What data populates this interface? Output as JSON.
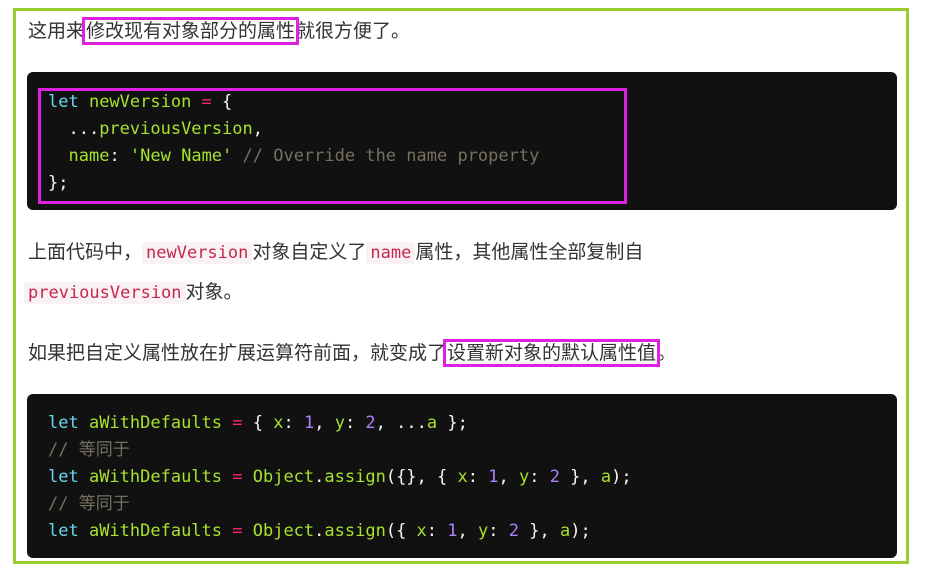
{
  "para1": {
    "before": "这用来",
    "highlight": "修改现有对象部分的属性",
    "after": "就很方便了。"
  },
  "code1": [
    [
      [
        "let ",
        "kw"
      ],
      [
        "newVersion ",
        "fn"
      ],
      [
        "= ",
        "op"
      ],
      [
        "{",
        "pl"
      ]
    ],
    [
      [
        "  ...",
        "pl"
      ],
      [
        "previousVersion",
        "fn"
      ],
      [
        ",",
        "pl"
      ]
    ],
    [
      [
        "  ",
        "pl"
      ],
      [
        "name",
        "fn"
      ],
      [
        ": ",
        "pl"
      ],
      [
        "'New Name'",
        "str"
      ],
      [
        " // Override the name property",
        "cm"
      ]
    ],
    [
      [
        "};",
        "pl"
      ]
    ]
  ],
  "para2": {
    "t1": "上面代码中，",
    "c1": "newVersion",
    "t2": "对象自定义了",
    "c2": "name",
    "t3": "属性，其他属性全部复制自",
    "c3": "previousVersion",
    "t4": "对象。"
  },
  "para3": {
    "before": "如果把自定义属性放在扩展运算符前面，就变成了",
    "highlight": "设置新对象的默认属性值",
    "after": "。"
  },
  "code2": [
    [
      [
        "let ",
        "kw"
      ],
      [
        "aWithDefaults ",
        "fn"
      ],
      [
        "= ",
        "op"
      ],
      [
        "{ ",
        "pl"
      ],
      [
        "x",
        "fn"
      ],
      [
        ": ",
        "pl"
      ],
      [
        "1",
        "num"
      ],
      [
        ", ",
        "pl"
      ],
      [
        "y",
        "fn"
      ],
      [
        ": ",
        "pl"
      ],
      [
        "2",
        "num"
      ],
      [
        ", ...",
        "pl"
      ],
      [
        "a",
        "fn"
      ],
      [
        " };",
        "pl"
      ]
    ],
    [
      [
        "// 等同于",
        "cm"
      ]
    ],
    [
      [
        "let ",
        "kw"
      ],
      [
        "aWithDefaults ",
        "fn"
      ],
      [
        "= ",
        "op"
      ],
      [
        "Object",
        "fn"
      ],
      [
        ".",
        "pl"
      ],
      [
        "assign",
        "fn"
      ],
      [
        "({}, { ",
        "pl"
      ],
      [
        "x",
        "fn"
      ],
      [
        ": ",
        "pl"
      ],
      [
        "1",
        "num"
      ],
      [
        ", ",
        "pl"
      ],
      [
        "y",
        "fn"
      ],
      [
        ": ",
        "pl"
      ],
      [
        "2",
        "num"
      ],
      [
        " }, ",
        "pl"
      ],
      [
        "a",
        "fn"
      ],
      [
        ");",
        "pl"
      ]
    ],
    [
      [
        "// 等同于",
        "cm"
      ]
    ],
    [
      [
        "let ",
        "kw"
      ],
      [
        "aWithDefaults ",
        "fn"
      ],
      [
        "= ",
        "op"
      ],
      [
        "Object",
        "fn"
      ],
      [
        ".",
        "pl"
      ],
      [
        "assign",
        "fn"
      ],
      [
        "({ ",
        "pl"
      ],
      [
        "x",
        "fn"
      ],
      [
        ": ",
        "pl"
      ],
      [
        "1",
        "num"
      ],
      [
        ", ",
        "pl"
      ],
      [
        "y",
        "fn"
      ],
      [
        ": ",
        "pl"
      ],
      [
        "2",
        "num"
      ],
      [
        " }, ",
        "pl"
      ],
      [
        "a",
        "fn"
      ],
      [
        ");",
        "pl"
      ]
    ]
  ],
  "colors": {
    "frame": "#9acd32",
    "highlight": "#e020e0",
    "code_bg": "#111111"
  }
}
